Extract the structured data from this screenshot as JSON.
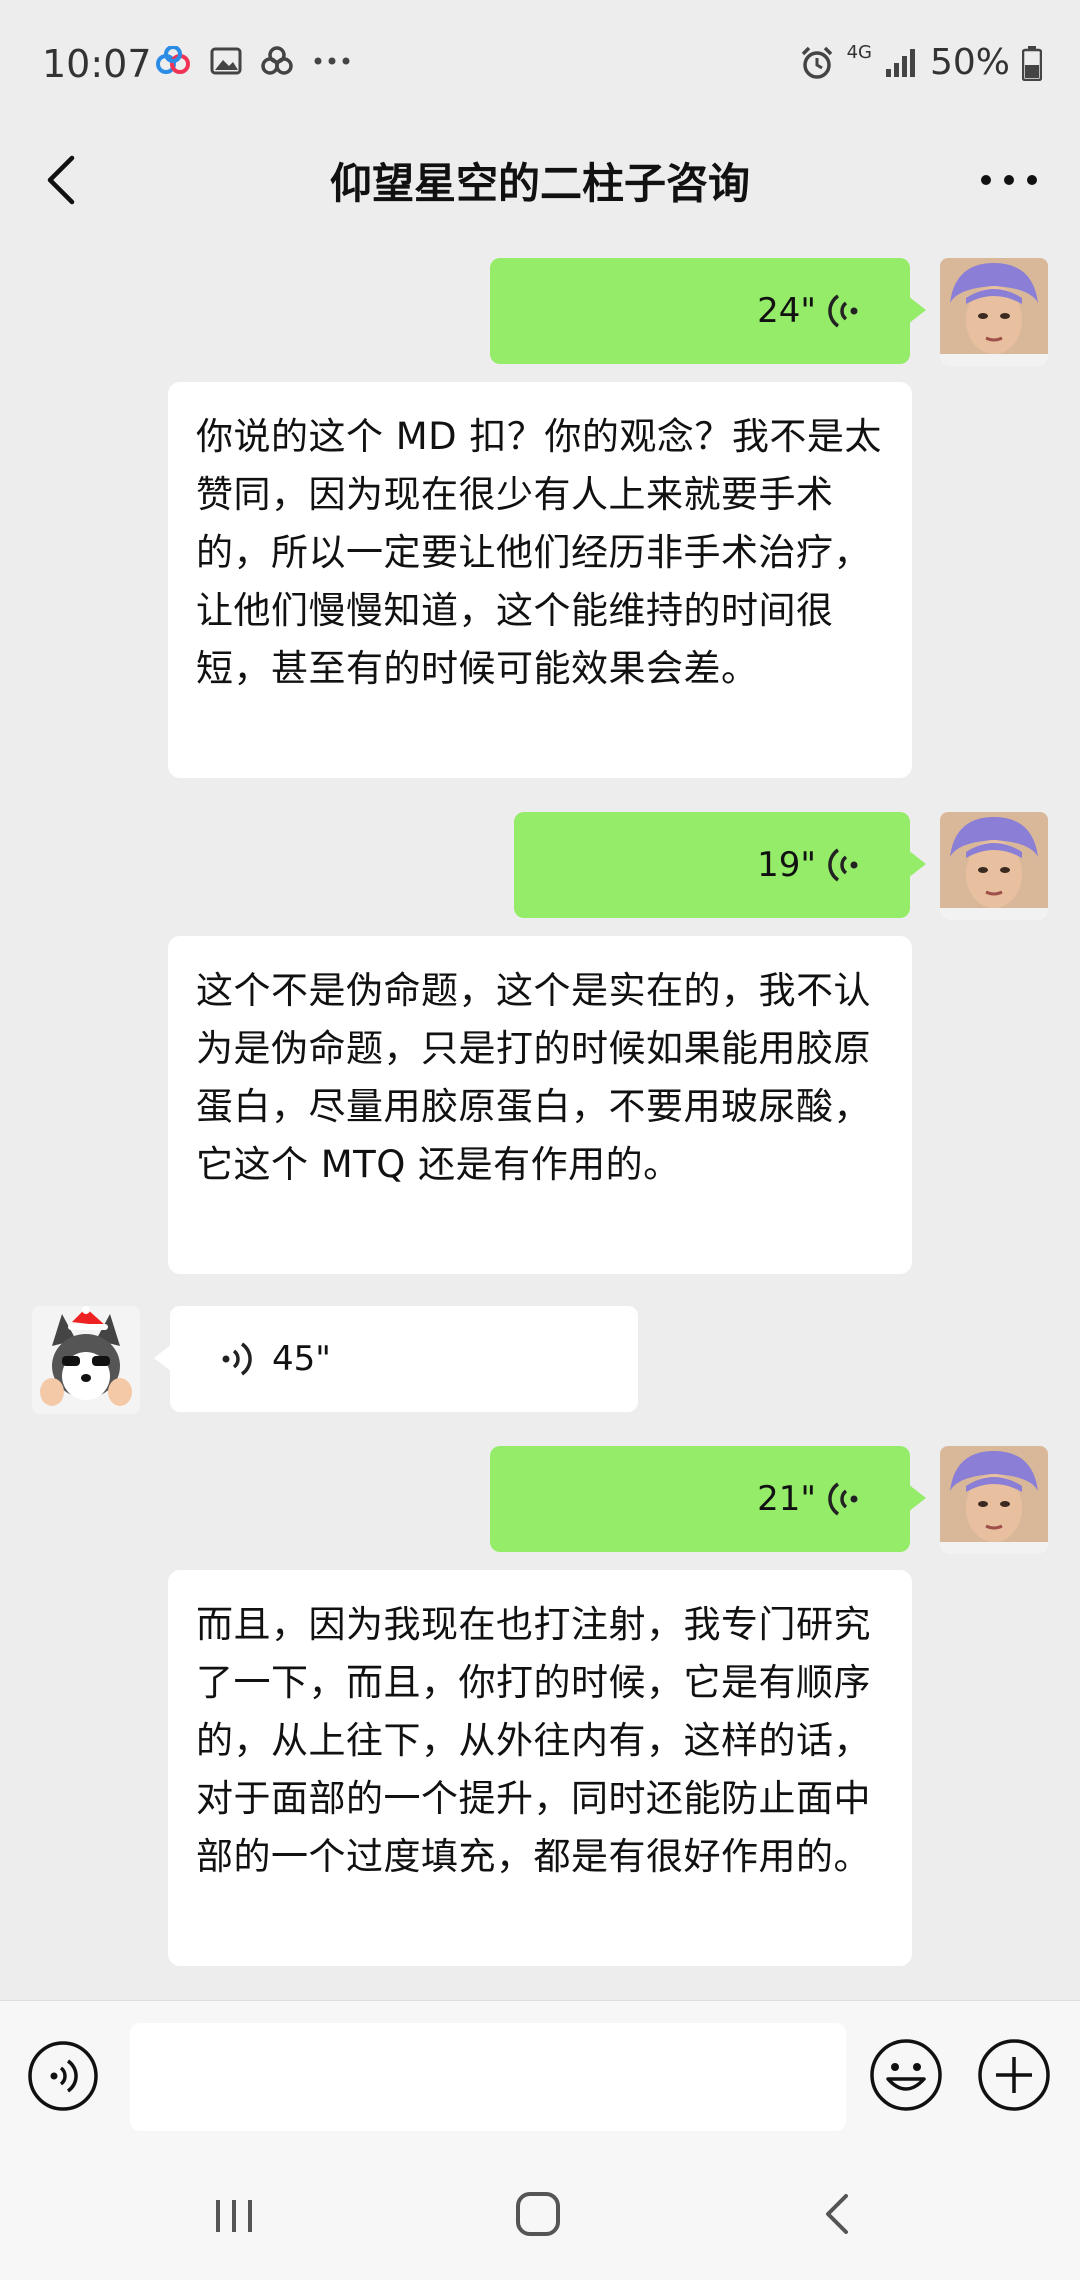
{
  "status_bar": {
    "time": "10:07",
    "left_icons": [
      "app-notification-icon",
      "gallery-icon",
      "app-icon",
      "more-dots-icon"
    ],
    "network": "4G",
    "battery": "50%"
  },
  "header": {
    "title": "仰望星空的二柱子咨询",
    "back_icon": "chevron-left-icon",
    "more_icon": "ellipsis-icon"
  },
  "messages": [
    {
      "side": "right",
      "type": "voice",
      "duration": "24\""
    },
    {
      "side": "right",
      "type": "text",
      "text": "你说的这个 MD 扣？你的观念？我不是太赞同，因为现在很少有人上来就要手术的，所以一定要让他们经历非手术治疗，让他们慢慢知道，这个能维持的时间很短，甚至有的时候可能效果会差。"
    },
    {
      "side": "right",
      "type": "voice",
      "duration": "19\""
    },
    {
      "side": "right",
      "type": "text",
      "text": "这个不是伪命题，这个是实在的，我不认为是伪命题，只是打的时候如果能用胶原蛋白，尽量用胶原蛋白，不要用玻尿酸，它这个 MTQ 还是有作用的。"
    },
    {
      "side": "left",
      "type": "voice",
      "duration": "45\""
    },
    {
      "side": "right",
      "type": "voice",
      "duration": "21\""
    },
    {
      "side": "right",
      "type": "text",
      "text": "而且，因为我现在也打注射，我专门研究了一下，而且，你打的时候，它是有顺序的，从上往下，从外往内有，这样的话，对于面部的一个提升，同时还能防止面中部的一个过度填充，都是有很好作用的。"
    }
  ],
  "colors": {
    "background": "#ededed",
    "self_bubble": "#95ec69",
    "other_bubble": "#ffffff"
  },
  "input_bar": {
    "voice_icon": "voice-input-icon",
    "emoji_icon": "emoji-icon",
    "plus_icon": "plus-icon",
    "input_value": ""
  },
  "nav_bar": {
    "icons": [
      "recent-apps-icon",
      "home-icon",
      "back-icon"
    ]
  }
}
